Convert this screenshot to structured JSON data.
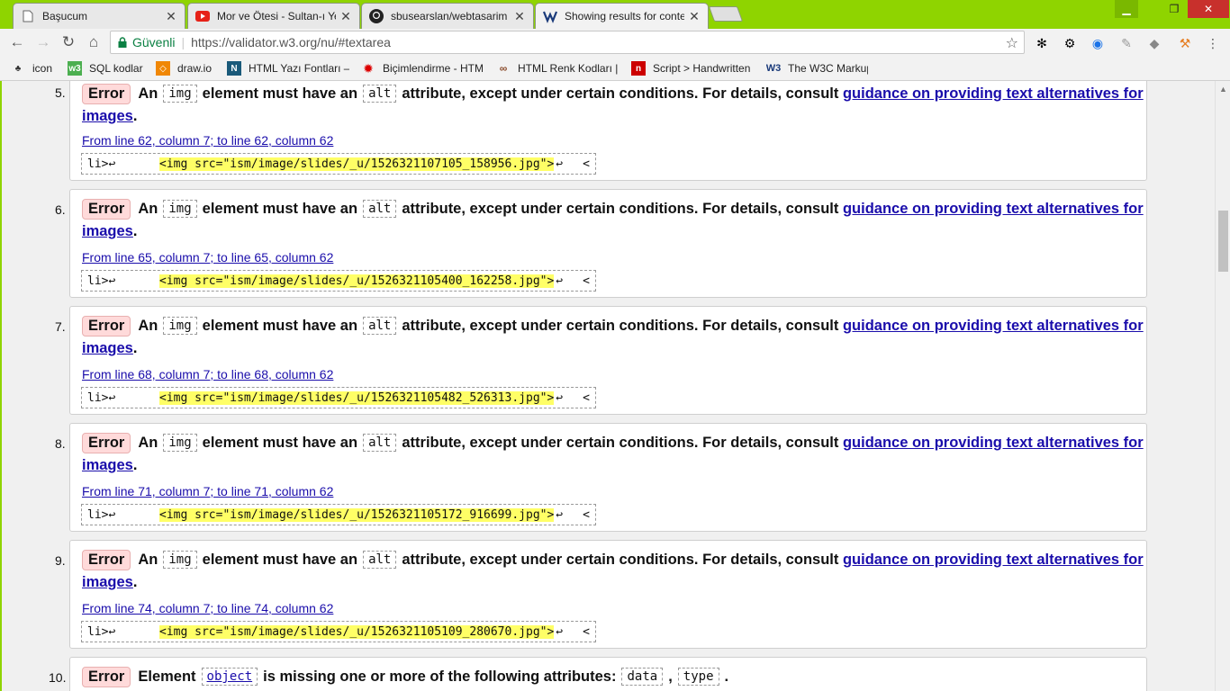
{
  "tabs": [
    {
      "label": "Başucum",
      "icon": "page-icon",
      "active": false
    },
    {
      "label": "Mor ve Ötesi - Sultan-ı Ye",
      "icon": "youtube-icon",
      "active": false
    },
    {
      "label": "sbusearslan/webtasarim",
      "icon": "github-icon",
      "active": false
    },
    {
      "label": "Showing results for conte",
      "icon": "w3c-validator-icon",
      "active": true
    }
  ],
  "toolbar": {
    "secure_label": "Güvenli",
    "url": "https://validator.w3.org/nu/#textarea"
  },
  "bookmarks": [
    {
      "label": "icon",
      "icon": "icon-bookmark-icon"
    },
    {
      "label": "SQL kodlar",
      "icon": "w3schools-icon"
    },
    {
      "label": "draw.io",
      "icon": "drawio-icon"
    },
    {
      "label": "HTML Yazı Fontları –",
      "icon": "n-letter-icon"
    },
    {
      "label": "Biçimlendirme - HTM",
      "icon": "gear-red-icon"
    },
    {
      "label": "HTML Renk Kodları |",
      "icon": "glasses-icon"
    },
    {
      "label": "Script > Handwritten",
      "icon": "font-site-icon"
    },
    {
      "label": "The W3C Markup Va",
      "icon": "w3c-icon"
    }
  ],
  "messages": [
    {
      "num": "5.",
      "type": "Error",
      "pre": "An",
      "code1": "img",
      "mid": "element must have an",
      "code2": "alt",
      "post": "attribute, except under certain conditions. For details, consult",
      "link": "guidance on providing text alternatives for",
      "link2": "images",
      "dot": ".",
      "location": "From line 62, column 7; to line 62, column 62",
      "extract_pre": "li>↩",
      "extract_hl": "<img src=\"ism/image/slides/_u/1526321107105_158956.jpg\">",
      "extract_ret": "↩",
      "extract_tail": "<"
    },
    {
      "num": "6.",
      "type": "Error",
      "pre": "An",
      "code1": "img",
      "mid": "element must have an",
      "code2": "alt",
      "post": "attribute, except under certain conditions. For details, consult",
      "link": "guidance on providing text alternatives for",
      "link2": "images",
      "dot": ".",
      "location": "From line 65, column 7; to line 65, column 62",
      "extract_pre": "li>↩",
      "extract_hl": "<img src=\"ism/image/slides/_u/1526321105400_162258.jpg\">",
      "extract_ret": "↩",
      "extract_tail": "<"
    },
    {
      "num": "7.",
      "type": "Error",
      "pre": "An",
      "code1": "img",
      "mid": "element must have an",
      "code2": "alt",
      "post": "attribute, except under certain conditions. For details, consult",
      "link": "guidance on providing text alternatives for",
      "link2": "images",
      "dot": ".",
      "location": "From line 68, column 7; to line 68, column 62",
      "extract_pre": "li>↩",
      "extract_hl": "<img src=\"ism/image/slides/_u/1526321105482_526313.jpg\">",
      "extract_ret": "↩",
      "extract_tail": "<"
    },
    {
      "num": "8.",
      "type": "Error",
      "pre": "An",
      "code1": "img",
      "mid": "element must have an",
      "code2": "alt",
      "post": "attribute, except under certain conditions. For details, consult",
      "link": "guidance on providing text alternatives for",
      "link2": "images",
      "dot": ".",
      "location": "From line 71, column 7; to line 71, column 62",
      "extract_pre": "li>↩",
      "extract_hl": "<img src=\"ism/image/slides/_u/1526321105172_916699.jpg\">",
      "extract_ret": "↩",
      "extract_tail": "<"
    },
    {
      "num": "9.",
      "type": "Error",
      "pre": "An",
      "code1": "img",
      "mid": "element must have an",
      "code2": "alt",
      "post": "attribute, except under certain conditions. For details, consult",
      "link": "guidance on providing text alternatives for",
      "link2": "images",
      "dot": ".",
      "location": "From line 74, column 7; to line 74, column 62",
      "extract_pre": "li>↩",
      "extract_hl": "<img src=\"ism/image/slides/_u/1526321105109_280670.jpg\">",
      "extract_ret": "↩",
      "extract_tail": "<"
    }
  ],
  "last_message": {
    "num": "10.",
    "type": "Error",
    "pre": "Element",
    "code1": "object",
    "mid": "is missing one or more of the following attributes:",
    "code2": "data",
    "comma": ",",
    "code3": "type",
    "dot": "."
  },
  "colors": {
    "chrome_accent": "#8fd400",
    "error_badge": "#ffdada",
    "highlight": "#ffff66",
    "link": "#1a0dab"
  }
}
